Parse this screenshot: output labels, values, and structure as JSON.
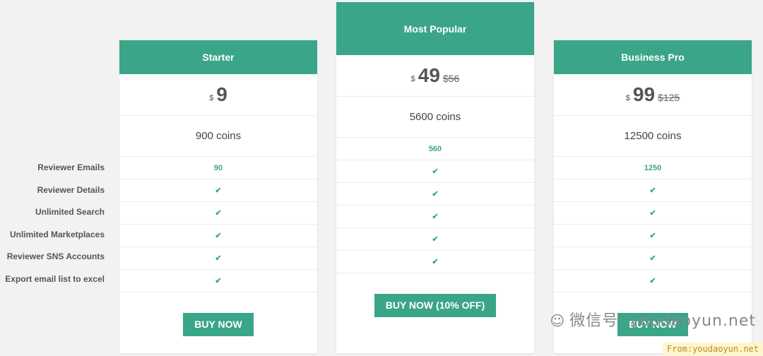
{
  "features": [
    "Reviewer Emails",
    "Reviewer Details",
    "Unlimited Search",
    "Unlimited Marketplaces",
    "Reviewer SNS Accounts",
    "Export email list to excel"
  ],
  "plans": [
    {
      "name": "Starter",
      "currency": "$",
      "price": "9",
      "old_price": "",
      "coins": "900 coins",
      "emails": "90",
      "button": "BUY NOW"
    },
    {
      "name": "Most Popular",
      "currency": "$",
      "price": "49",
      "old_price": "$56",
      "coins": "5600 coins",
      "emails": "560",
      "button": "BUY NOW (10% OFF)"
    },
    {
      "name": "Business Pro",
      "currency": "$",
      "price": "99",
      "old_price": "$125",
      "coins": "12500 coins",
      "emails": "1250",
      "button": "BUY NOW"
    }
  ],
  "check_glyph": "✔",
  "watermark": {
    "text": "微信号: youdaoyun.net",
    "icon": "wechat-icon",
    "from": "From:youdaoyun.net"
  },
  "colors": {
    "accent": "#3aa588",
    "background": "#f2f2f2"
  }
}
